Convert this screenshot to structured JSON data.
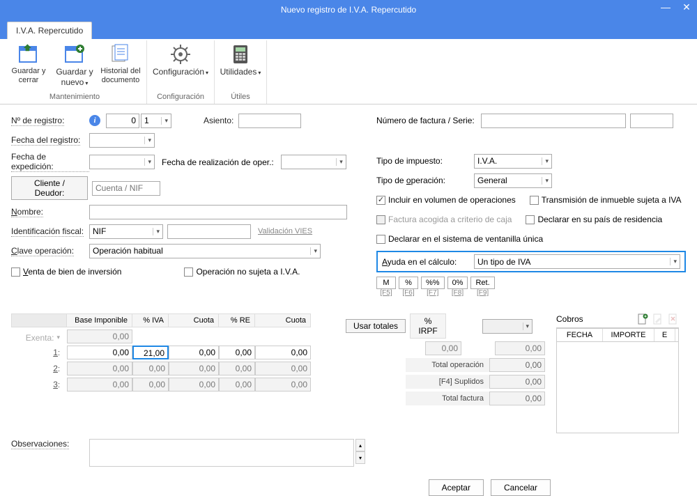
{
  "window": {
    "title": "Nuevo registro de I.V.A. Repercutido"
  },
  "tab": {
    "label": "I.V.A. Repercutido"
  },
  "ribbon": {
    "save_close": "Guardar y cerrar",
    "save_new": "Guardar y nuevo",
    "history": "Historial del documento",
    "config": "Configuración",
    "utils": "Utilidades",
    "group_maint": "Mantenimiento",
    "group_config": "Configuración",
    "group_utils": "Útiles"
  },
  "labels": {
    "nregistro": "Nº de registro:",
    "asiento": "Asiento:",
    "numfactura": "Número de factura / Serie:",
    "fecha_reg": "Fecha del registro:",
    "fecha_exp": "Fecha de expedición:",
    "fecha_real": "Fecha de realización de oper.:",
    "cliente": "Cliente / Deudor:",
    "cliente_ph": "Cuenta / NIF",
    "nombre": "Nombre:",
    "id_fiscal": "Identificación fiscal:",
    "nif_opt": "NIF",
    "vies": "Validación VIES",
    "clave_op": "Clave operación:",
    "clave_op_val": "Operación habitual",
    "venta_bien": "Venta de bien de inversión",
    "no_sujeta": "Operación no sujeta a I.V.A.",
    "tipo_impuesto": "Tipo de impuesto:",
    "tipo_impuesto_val": "I.V.A.",
    "tipo_operacion": "Tipo de operación:",
    "tipo_operacion_val": "General",
    "incluir_vol": "Incluir en volumen de operaciones",
    "transmision": "Transmisión de inmueble sujeta a IVA",
    "factura_caja": "Factura acogida a criterio de caja",
    "declarar_pais": "Declarar en su país de residencia",
    "declarar_ventanilla": "Declarar en el sistema de ventanilla única",
    "ayuda_calc": "Ayuda en el cálculo:",
    "ayuda_calc_val": "Un tipo de IVA",
    "usar_totales": "Usar totales",
    "observaciones": "Observaciones:",
    "aceptar": "Aceptar",
    "cancelar": "Cancelar"
  },
  "reg": {
    "num": "0",
    "serie": "1"
  },
  "smallbtns": {
    "m": "M",
    "pct": "%",
    "pctpct": "%%",
    "zero": "0%",
    "ret": "Ret.",
    "f5": "[F5]",
    "f6": "[F6]",
    "f7": "[F7]",
    "f8": "[F8]",
    "f9": "[F9]"
  },
  "gridhead": {
    "base": "Base Imponible",
    "iva": "% IVA",
    "cuota": "Cuota",
    "re": "% RE",
    "cuota2": "Cuota",
    "irpf": "% IRPF"
  },
  "gridrows": {
    "exenta": "Exenta:",
    "r1": "1:",
    "r2": "2:",
    "r3": "3:"
  },
  "gridvals": {
    "ex_base": "0,00",
    "r1_base": "0,00",
    "r1_iva": "21,00",
    "r1_cuota": "0,00",
    "r1_re": "0,00",
    "r1_cuota2": "0,00",
    "r2_base": "0,00",
    "r2_iva": "0,00",
    "r2_cuota": "0,00",
    "r2_re": "0,00",
    "r2_cuota2": "0,00",
    "r3_base": "0,00",
    "r3_iva": "0,00",
    "r3_cuota": "0,00",
    "r3_re": "0,00",
    "r3_cuota2": "0,00",
    "irpf_val": "0,00",
    "irpf_amt": "0,00"
  },
  "totals": {
    "total_op_lbl": "Total operación",
    "total_op": "0,00",
    "suplidos_lbl": "[F4] Suplidos",
    "suplidos": "0,00",
    "total_fact_lbl": "Total factura",
    "total_fact": "0,00"
  },
  "cobros": {
    "title": "Cobros",
    "col_fecha": "FECHA",
    "col_importe": "IMPORTE",
    "col_e": "E"
  }
}
